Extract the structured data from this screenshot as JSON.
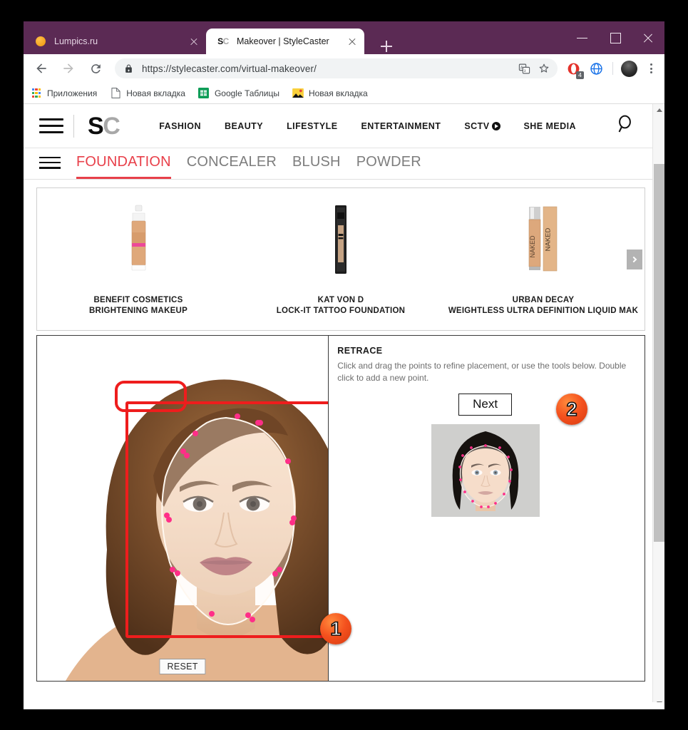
{
  "browser": {
    "tabs": [
      {
        "title": "Lumpics.ru",
        "favicon": "orange-circle-icon",
        "active": false
      },
      {
        "title": "Makeover | StyleCaster",
        "favicon": "sc-logo-icon",
        "active": true
      }
    ],
    "new_tab_label": "+",
    "window_controls": {
      "minimize": "minimize-icon",
      "maximize": "maximize-icon",
      "close": "close-icon"
    },
    "nav": {
      "back": "back-arrow-icon",
      "forward": "forward-arrow-icon",
      "reload": "reload-icon"
    },
    "omnibox": {
      "url": "https://stylecaster.com/virtual-makeover/",
      "lock": "lock-icon",
      "translate": "translate-icon",
      "bookmark": "star-icon"
    },
    "extensions": [
      {
        "name": "opera-extension-icon",
        "badge": "4"
      },
      {
        "name": "globe-extension-icon",
        "badge": ""
      }
    ],
    "profile": "avatar-icon",
    "menu": "kebab-menu-icon",
    "bookmarks": [
      {
        "label": "Приложения",
        "icon": "apps-grid-icon"
      },
      {
        "label": "Новая вкладка",
        "icon": "document-icon"
      },
      {
        "label": "Google Таблицы",
        "icon": "sheets-icon"
      },
      {
        "label": "Новая вкладка",
        "icon": "photos-icon"
      }
    ],
    "titlebar_color": "#5b2a54"
  },
  "site": {
    "logo": {
      "s": "S",
      "c": "C"
    },
    "menu_icon": "hamburger-icon",
    "nav_links": [
      {
        "label": "FASHION",
        "has_play": false
      },
      {
        "label": "BEAUTY",
        "has_play": false
      },
      {
        "label": "LIFESTYLE",
        "has_play": false
      },
      {
        "label": "ENTERTAINMENT",
        "has_play": false
      },
      {
        "label": "SCTV",
        "has_play": true
      },
      {
        "label": "SHE MEDIA",
        "has_play": false
      }
    ],
    "search_icon": "search-icon"
  },
  "product_tabs": {
    "menu_icon": "hamburger-icon",
    "items": [
      {
        "label": "FOUNDATION",
        "active": true
      },
      {
        "label": "CONCEALER",
        "active": false
      },
      {
        "label": "BLUSH",
        "active": false
      },
      {
        "label": "POWDER",
        "active": false
      }
    ],
    "active_color": "#e8404a"
  },
  "carousel": {
    "next_label": "chevron-right-icon",
    "products": [
      {
        "brand": "BENEFIT COSMETICS",
        "name": "BRIGHTENING MAKEUP"
      },
      {
        "brand": "KAT VON D",
        "name": "LOCK-IT TATTOO FOUNDATION"
      },
      {
        "brand": "URBAN DECAY",
        "name": "WEIGHTLESS ULTRA DEFINITION LIQUID MAK"
      }
    ]
  },
  "editor": {
    "reset_label": "RESET",
    "tools": {
      "title": "RETRACE",
      "description": "Click and drag the points to refine placement, or use the tools below. Double click to add a new point.",
      "next_label": "Next"
    }
  },
  "annotations": [
    {
      "badge": "1",
      "target": "face-trace-area"
    },
    {
      "badge": "2",
      "target": "next-button"
    }
  ]
}
